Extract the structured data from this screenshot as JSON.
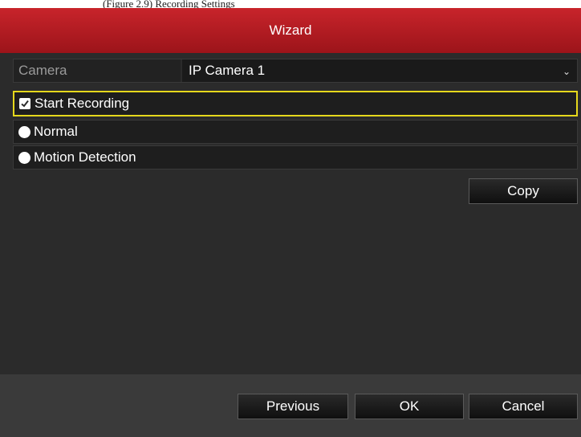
{
  "page_caption": "(Figure 2.9) Recording Settings",
  "dialog": {
    "title": "Wizard"
  },
  "camera": {
    "label": "Camera",
    "selected": "IP Camera 1"
  },
  "options": {
    "start_recording": {
      "label": "Start Recording",
      "checked": true
    },
    "normal": {
      "label": "Normal",
      "selected": false
    },
    "motion_detection": {
      "label": "Motion Detection",
      "selected": false
    }
  },
  "buttons": {
    "copy": "Copy",
    "previous": "Previous",
    "ok": "OK",
    "cancel": "Cancel"
  },
  "colors": {
    "title_bar": "#b81c22",
    "focus_highlight": "#e6d81c",
    "dialog_bg": "#2b2b2b"
  },
  "icons": {
    "checkbox": "checkbox-checked-icon",
    "radio": "radio-icon",
    "dropdown": "chevron-down-icon"
  }
}
